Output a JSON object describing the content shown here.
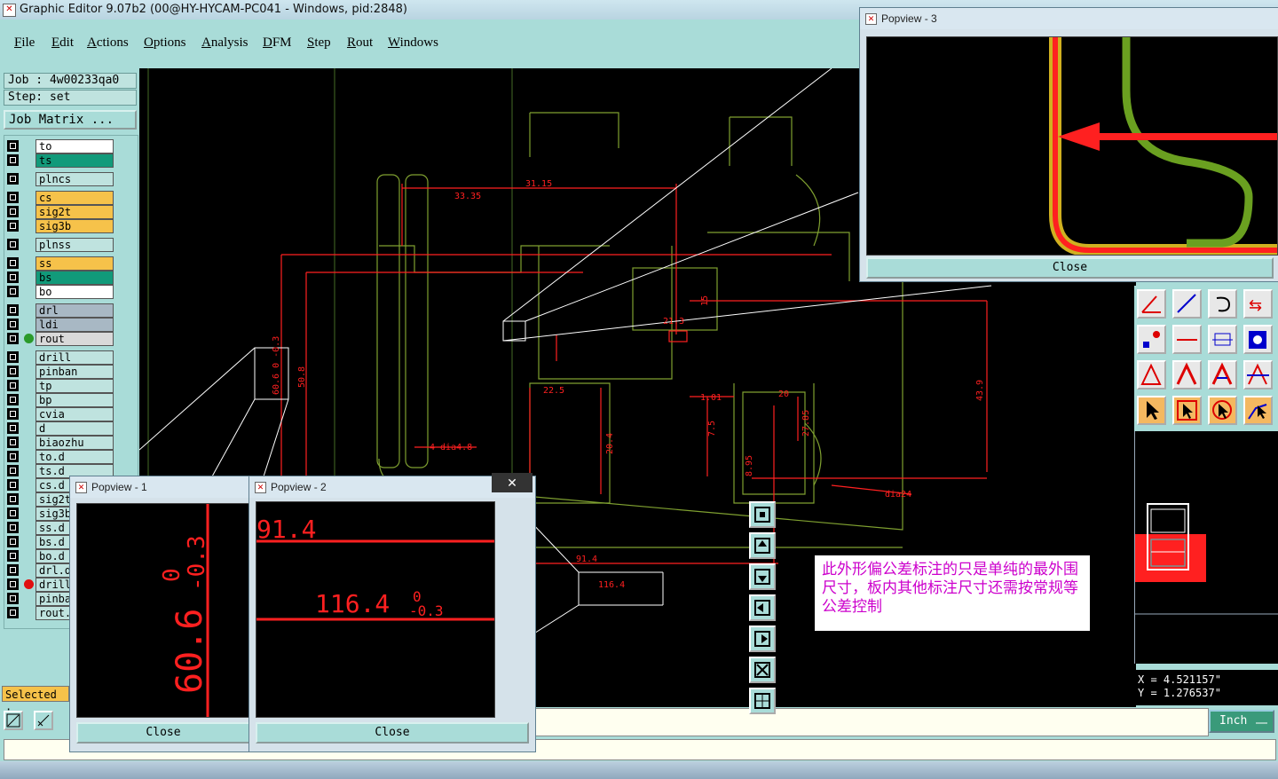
{
  "window": {
    "title": "Graphic Editor 9.07b2 (00@HY-HYCAM-PC041 - Windows, pid:2848)"
  },
  "menu": [
    "File",
    "Edit",
    "Actions",
    "Options",
    "Analysis",
    "DFM",
    "Step",
    "Rout",
    "Windows"
  ],
  "job": {
    "job_label": "Job : 4w00233qa0",
    "step_label": "Step: set",
    "matrix_button": "Job Matrix ..."
  },
  "layers": [
    {
      "name": "to",
      "bg": "#ffffff"
    },
    {
      "name": "ts",
      "bg": "#119a7a"
    },
    {
      "name": "plncs",
      "bg": "#bfe3df"
    },
    {
      "name": "cs",
      "bg": "#f6c24a"
    },
    {
      "name": "sig2t",
      "bg": "#f6c24a"
    },
    {
      "name": "sig3b",
      "bg": "#f6c24a"
    },
    {
      "name": "plnss",
      "bg": "#bfe3df"
    },
    {
      "name": "ss",
      "bg": "#f6c24a"
    },
    {
      "name": "bs",
      "bg": "#119a7a"
    },
    {
      "name": "bo",
      "bg": "#ffffff"
    },
    {
      "name": "drl",
      "bg": "#a8b8c4"
    },
    {
      "name": "ldi",
      "bg": "#a8b8c4"
    },
    {
      "name": "rout",
      "bg": "#d9d9d9"
    },
    {
      "name": "drill",
      "bg": "#bfe3df"
    },
    {
      "name": "pinban",
      "bg": "#bfe3df"
    },
    {
      "name": "tp",
      "bg": "#bfe3df"
    },
    {
      "name": "bp",
      "bg": "#bfe3df"
    },
    {
      "name": "cvia",
      "bg": "#bfe3df"
    },
    {
      "name": "d",
      "bg": "#bfe3df"
    },
    {
      "name": "biaozhu",
      "bg": "#bfe3df"
    },
    {
      "name": "to.d",
      "bg": "#bfe3df"
    },
    {
      "name": "ts.d",
      "bg": "#bfe3df"
    },
    {
      "name": "cs.d",
      "bg": "#bfe3df"
    },
    {
      "name": "sig2t",
      "bg": "#bfe3df"
    },
    {
      "name": "sig3b",
      "bg": "#bfe3df"
    },
    {
      "name": "ss.d",
      "bg": "#bfe3df"
    },
    {
      "name": "bs.d",
      "bg": "#bfe3df"
    },
    {
      "name": "bo.d",
      "bg": "#bfe3df"
    },
    {
      "name": "drl.d",
      "bg": "#bfe3df"
    },
    {
      "name": "drill",
      "bg": "#bfe3df"
    },
    {
      "name": "pinba",
      "bg": "#bfe3df"
    },
    {
      "name": "rout.",
      "bg": "#bfe3df"
    }
  ],
  "selected_label": "Selected :",
  "dimensions": {
    "d1": "33.35",
    "d2": "31.15",
    "d3": "50.8",
    "d4": "60.6 0 -0.3",
    "d5": "21.3",
    "d6": "15",
    "d7": "43.9",
    "d8": "22.5",
    "d9": "20",
    "d10": "1.01",
    "d11": "27.85",
    "d12": "20.4",
    "d13": "7.5",
    "d14": "4-dia4.8",
    "d15": "dia24",
    "d16": "91.4",
    "d17": "116.4",
    "d18": "8.95"
  },
  "popview1": {
    "title": "Popview - 1",
    "value": "60.6",
    "tol_upper": "0",
    "tol_lower": "-0.3",
    "close": "Close"
  },
  "popview2": {
    "title": "Popview - 2",
    "value_top": "91.4",
    "value": "116.4",
    "tol_upper": "0",
    "tol_lower": "-0.3",
    "close": "Close"
  },
  "popview3": {
    "title": "Popview - 3",
    "close": "Close"
  },
  "note": "此外形偏公差标注的只是单纯的最外围尺寸，板内其他标注尺寸还需按常规等公差控制",
  "coords": {
    "x": "X = 4.521157\"",
    "y": "Y = 1.276537\""
  },
  "unit_button": "Inch",
  "close_x": "✕",
  "colors": {
    "accent": "#a9dcd8",
    "dim_red": "#ff2020",
    "outline_green": "#7fa030"
  }
}
